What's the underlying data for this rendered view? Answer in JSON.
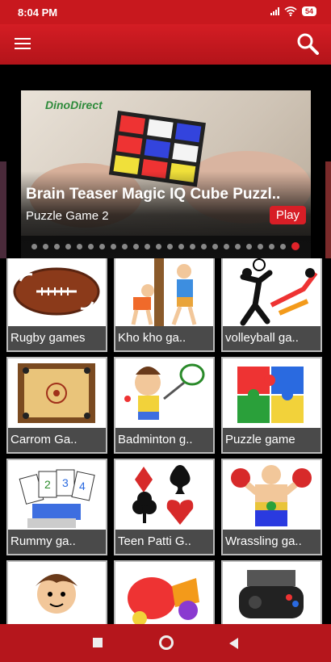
{
  "status_bar": {
    "time": "8:04 PM",
    "battery": "54"
  },
  "app_bar": {
    "menu_icon": "hamburger-menu-icon",
    "search_icon": "search-icon"
  },
  "banner": {
    "logo": "DinoDirect",
    "title": "Brain Teaser Magic IQ Cube Puzzl..",
    "subtitle": "Puzzle Game 2",
    "play_label": "Play",
    "page_count": 24,
    "active_page": 23
  },
  "games": [
    {
      "label": "Rugby games",
      "icon": "rugby-ball-icon"
    },
    {
      "label": "Kho kho ga..",
      "icon": "kho-kho-icon"
    },
    {
      "label": "volleyball ga..",
      "icon": "volleyball-icon"
    },
    {
      "label": "Carrom Ga..",
      "icon": "carrom-board-icon"
    },
    {
      "label": "Badminton g..",
      "icon": "badminton-icon"
    },
    {
      "label": "Puzzle game",
      "icon": "puzzle-icon"
    },
    {
      "label": "Rummy ga..",
      "icon": "rummy-cards-icon"
    },
    {
      "label": "Teen Patti G..",
      "icon": "card-suits-icon"
    },
    {
      "label": "Wrassling ga..",
      "icon": "wrestler-icon"
    },
    {
      "label": "",
      "icon": "cartoon-boy-icon"
    },
    {
      "label": "",
      "icon": "candy-icon"
    },
    {
      "label": "",
      "icon": "gamepad-icon"
    }
  ],
  "nav": {
    "recent": "recent-apps-icon",
    "home": "home-icon",
    "back": "back-icon"
  },
  "colors": {
    "primary": "#c8181e",
    "accent": "#d71e26",
    "tile_label_bg": "#4a4a4a"
  }
}
